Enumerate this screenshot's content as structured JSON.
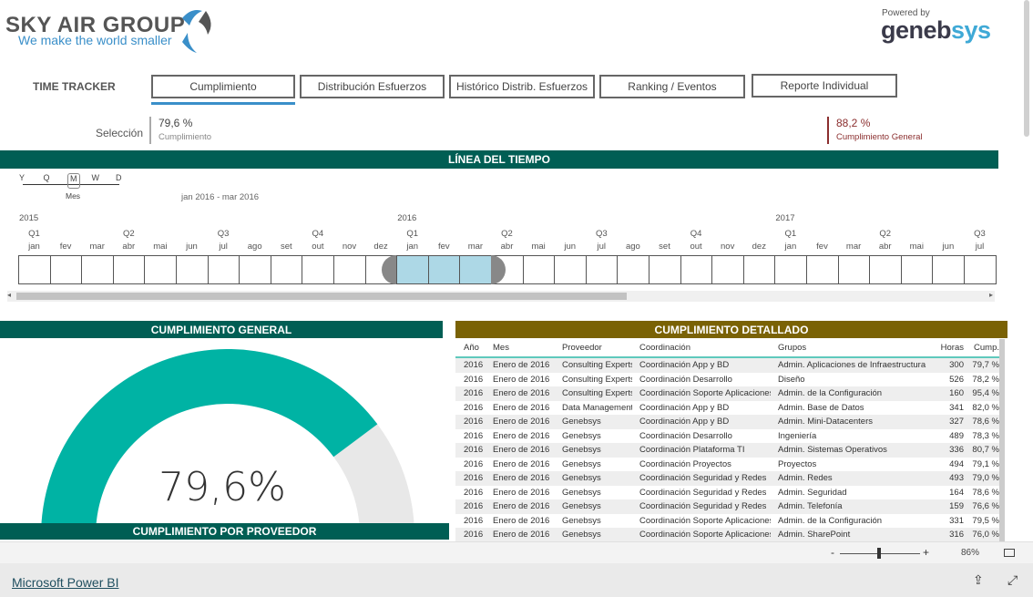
{
  "header": {
    "logo_name": "SKY AIR GROUP",
    "logo_tagline": "We make the world smaller",
    "powered_by": "Powered by",
    "powered_logo_a": "geneb",
    "powered_logo_b": "sys"
  },
  "nav": {
    "title": "TIME TRACKER",
    "tabs": [
      {
        "label": "Cumplimiento",
        "active": true
      },
      {
        "label": "Distribución Esfuerzos"
      },
      {
        "label": "Histórico Distrib. Esfuerzos"
      },
      {
        "label": "Ranking / Eventos"
      },
      {
        "label": "Reporte Individual"
      }
    ]
  },
  "kpis": {
    "selection_label": "Selección",
    "selection_value": "79,6 %",
    "selection_caption": "Cumplimiento",
    "general_value": "88,2 %",
    "general_caption": "Cumplimiento General",
    "general_color": "#8b2e2e"
  },
  "timeline": {
    "title": "LÍNEA DEL TIEMPO",
    "granularity": [
      "Y",
      "Q",
      "M",
      "W",
      "D"
    ],
    "granularity_selected": "M",
    "granularity_caption": "Mes",
    "range_text": "jan 2016 - mar 2016",
    "years": [
      {
        "label": "2015",
        "index": 0
      },
      {
        "label": "2016",
        "index": 12
      },
      {
        "label": "2017",
        "index": 24
      }
    ],
    "quarters": [
      {
        "label": "Q1",
        "index": 0
      },
      {
        "label": "Q2",
        "index": 3
      },
      {
        "label": "Q3",
        "index": 6
      },
      {
        "label": "Q4",
        "index": 9
      },
      {
        "label": "Q1",
        "index": 12
      },
      {
        "label": "Q2",
        "index": 15
      },
      {
        "label": "Q3",
        "index": 18
      },
      {
        "label": "Q4",
        "index": 21
      },
      {
        "label": "Q1",
        "index": 24
      },
      {
        "label": "Q2",
        "index": 27
      },
      {
        "label": "Q3",
        "index": 30
      }
    ],
    "months": [
      "jan",
      "fev",
      "mar",
      "abr",
      "mai",
      "jun",
      "jul",
      "ago",
      "set",
      "out",
      "nov",
      "dez",
      "jan",
      "fev",
      "mar",
      "abr",
      "mai",
      "jun",
      "jul",
      "ago",
      "set",
      "out",
      "nov",
      "dez",
      "jan",
      "fev",
      "mar",
      "abr",
      "mai",
      "jun",
      "jul"
    ],
    "selected_start": 12,
    "selected_end": 14,
    "scroll_position_fraction": 0.63
  },
  "gauge": {
    "title": "CUMPLIMIENTO GENERAL",
    "value": 79.6,
    "value_label": "79,6%",
    "max": 100,
    "fill_color": "#00b3a4",
    "track_color": "#e8e8e8"
  },
  "provider_title": "CUMPLIMIENTO POR PROVEEDOR",
  "table": {
    "title": "CUMPLIMIENTO DETALLADO",
    "columns": [
      "Año",
      "Mes",
      "Proveedor",
      "Coordinación",
      "Grupos",
      "Horas",
      "Cump."
    ],
    "rows": [
      [
        "2016",
        "Enero de 2016",
        "Consulting Experts",
        "Coordinación App y BD",
        "Admin. Aplicaciones de Infraestructura",
        "300",
        "79,7 %"
      ],
      [
        "2016",
        "Enero de 2016",
        "Consulting Experts",
        "Coordinación Desarrollo",
        "Diseño",
        "526",
        "78,2 %"
      ],
      [
        "2016",
        "Enero de 2016",
        "Consulting Experts",
        "Coordinación Soporte Aplicaciones",
        "Admin. de la Configuración",
        "160",
        "95,4 %"
      ],
      [
        "2016",
        "Enero de 2016",
        "Data Management",
        "Coordinación App y BD",
        "Admin. Base de Datos",
        "341",
        "82,0 %"
      ],
      [
        "2016",
        "Enero de 2016",
        "Genebsys",
        "Coordinación App y BD",
        "Admin. Mini-Datacenters",
        "327",
        "78,6 %"
      ],
      [
        "2016",
        "Enero de 2016",
        "Genebsys",
        "Coordinación Desarrollo",
        "Ingeniería",
        "489",
        "78,3 %"
      ],
      [
        "2016",
        "Enero de 2016",
        "Genebsys",
        "Coordinación Plataforma TI",
        "Admin. Sistemas Operativos",
        "336",
        "80,7 %"
      ],
      [
        "2016",
        "Enero de 2016",
        "Genebsys",
        "Coordinación Proyectos",
        "Proyectos",
        "494",
        "79,1 %"
      ],
      [
        "2016",
        "Enero de 2016",
        "Genebsys",
        "Coordinación Seguridad y Redes",
        "Admin. Redes",
        "493",
        "79,0 %"
      ],
      [
        "2016",
        "Enero de 2016",
        "Genebsys",
        "Coordinación Seguridad y Redes",
        "Admin. Seguridad",
        "164",
        "78,6 %"
      ],
      [
        "2016",
        "Enero de 2016",
        "Genebsys",
        "Coordinación Seguridad y Redes",
        "Admin. Telefonía",
        "159",
        "76,6 %"
      ],
      [
        "2016",
        "Enero de 2016",
        "Genebsys",
        "Coordinación Soporte Aplicaciones",
        "Admin. de la Configuración",
        "331",
        "79,5 %"
      ],
      [
        "2016",
        "Enero de 2016",
        "Genebsys",
        "Coordinación Soporte Aplicaciones",
        "Admin. SharePoint",
        "316",
        "76,0 %"
      ]
    ]
  },
  "zoom": {
    "minus": "-",
    "plus": "+",
    "level": "86%"
  },
  "footer": {
    "link": "Microsoft Power BI"
  }
}
